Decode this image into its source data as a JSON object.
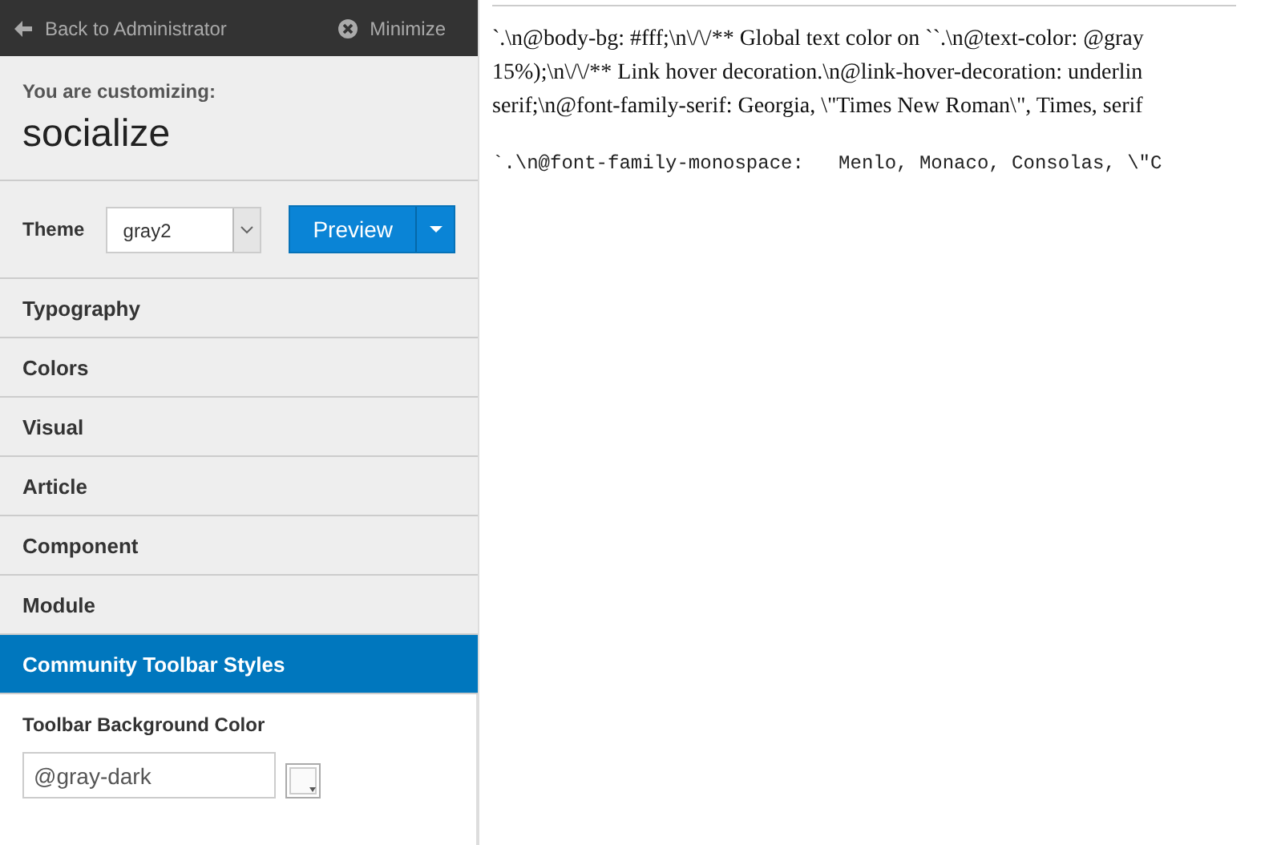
{
  "topbar": {
    "back": "Back to Administrator",
    "minimize": "Minimize"
  },
  "header": {
    "caption": "You are customizing:",
    "template": "socialize"
  },
  "theme": {
    "label": "Theme",
    "value": "gray2",
    "preview": "Preview"
  },
  "sections": [
    {
      "label": "Typography",
      "selected": false
    },
    {
      "label": "Colors",
      "selected": false
    },
    {
      "label": "Visual",
      "selected": false
    },
    {
      "label": "Article",
      "selected": false
    },
    {
      "label": "Component",
      "selected": false
    },
    {
      "label": "Module",
      "selected": false
    },
    {
      "label": "Community Toolbar Styles",
      "selected": true
    }
  ],
  "field": {
    "label": "Toolbar Background Color",
    "value": "@gray-dark"
  },
  "preview_text": {
    "lines": [
      "`.\\n@body-bg: #fff;\\n\\/\\/** Global text color on ``.\\n@text-color: @gray",
      "15%);\\n\\/\\/** Link hover decoration.\\n@link-hover-decoration: underlin",
      "serif;\\n@font-family-serif: Georgia, \\\"Times New Roman\\\", Times, serif"
    ],
    "mono": "`.\\n@font-family-monospace:   Menlo, Monaco, Consolas, \\\"C"
  }
}
